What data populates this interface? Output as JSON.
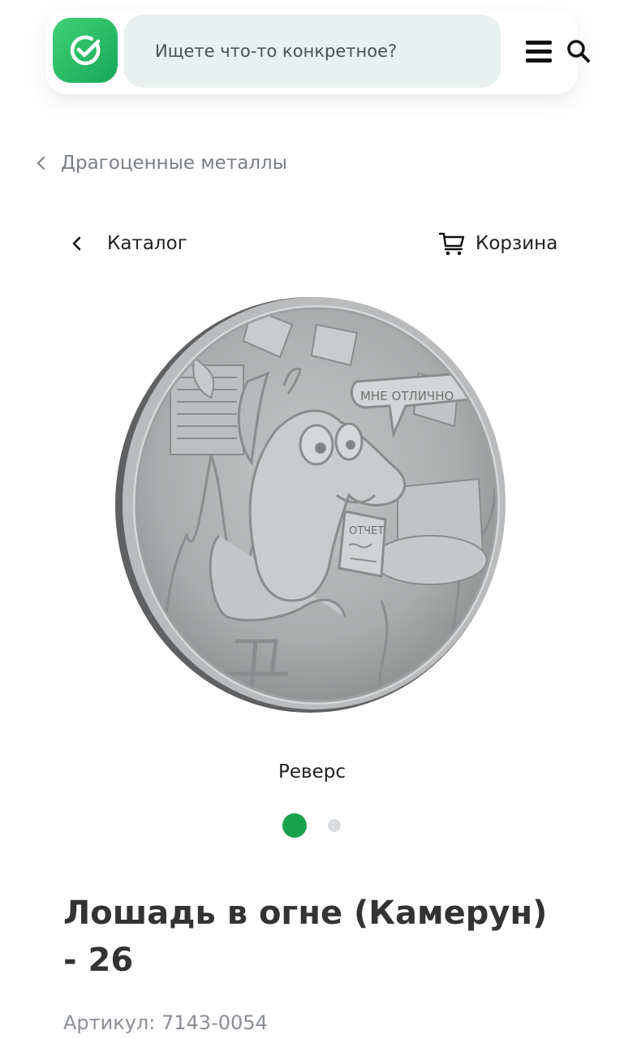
{
  "header": {
    "search": {
      "placeholder": "Ищете что-то конкретное?"
    },
    "menu_icon": "hamburger-menu-icon",
    "logo_icon": "checkmark-circle-icon",
    "colors": {
      "logo_green": "#21b665",
      "search_bg": "#e9f0ef"
    }
  },
  "breadcrumb": {
    "label": "Драгоценные металлы"
  },
  "nav": {
    "back_label": "Каталог",
    "cart_label": "Корзина"
  },
  "coin_text": {
    "speech_bubble": "МНЕ ОТЛИЧНО",
    "paper": "ОТЧЕТ"
  },
  "gallery": {
    "caption": "Реверс",
    "active_index": 0,
    "total": 2,
    "active_color": "#1aa14d"
  },
  "product": {
    "title": "Лошадь в огне (Камерун) - 26",
    "sku": "Артикул: 7143-0054"
  }
}
